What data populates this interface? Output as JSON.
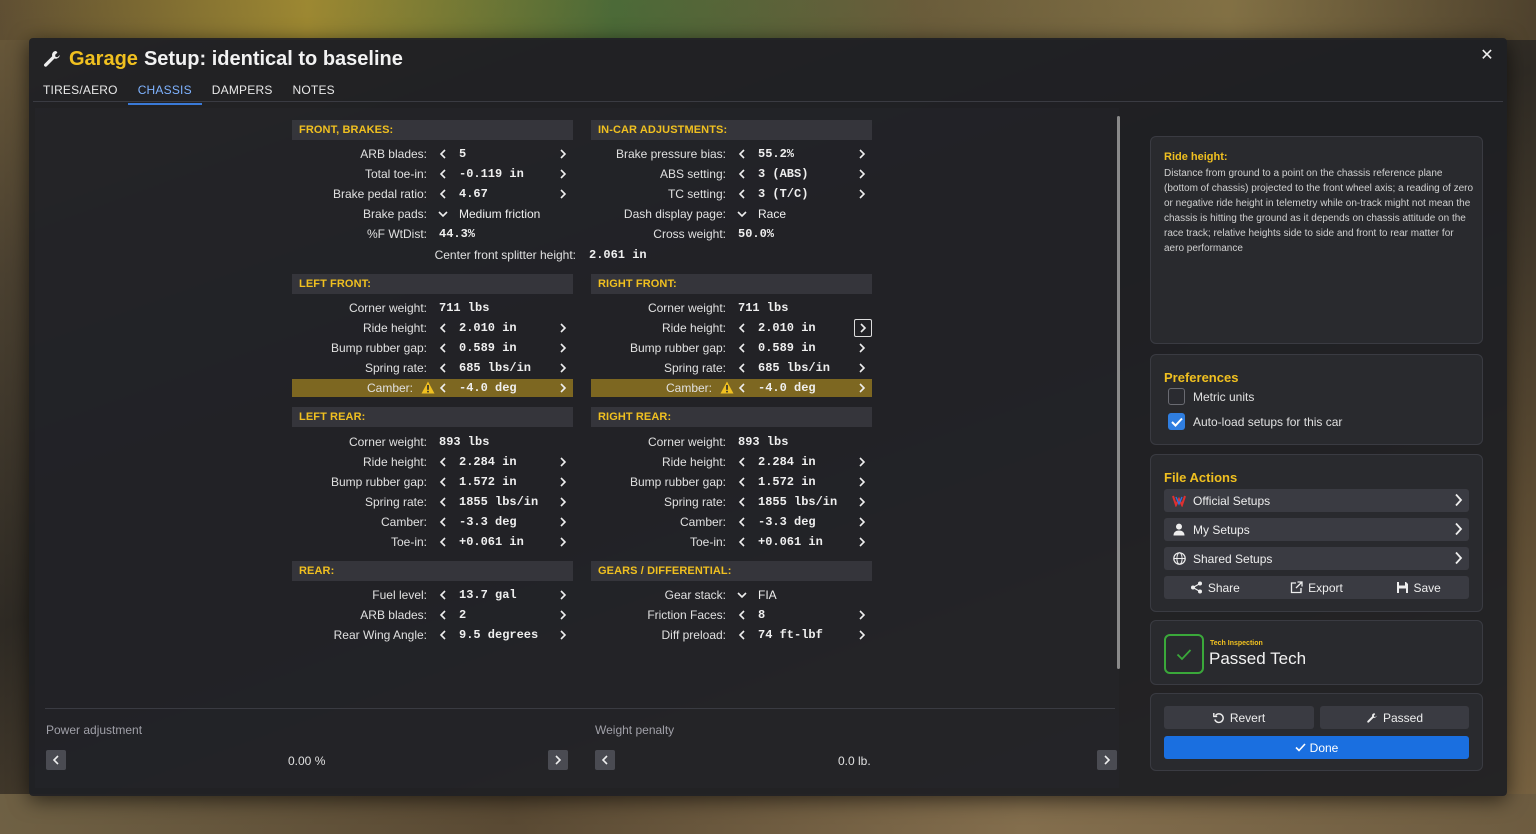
{
  "title": {
    "garage": "Garage",
    "main": "Setup: identical to baseline"
  },
  "tabs": [
    "TIRES/AERO",
    "CHASSIS",
    "DAMPERS",
    "NOTES"
  ],
  "sections": {
    "front_brakes": "FRONT, BRAKES:",
    "in_car": "IN-CAR ADJUSTMENTS:",
    "left_front": "LEFT FRONT:",
    "right_front": "RIGHT FRONT:",
    "left_rear": "LEFT REAR:",
    "right_rear": "RIGHT REAR:",
    "rear": "REAR:",
    "gears": "GEARS / DIFFERENTIAL:"
  },
  "front_brakes": [
    {
      "label": "ARB blades:",
      "value": "5"
    },
    {
      "label": "Total toe-in:",
      "value": "-0.119 in"
    },
    {
      "label": "Brake pedal ratio:",
      "value": "4.67"
    },
    {
      "label": "Brake pads:",
      "value": "Medium friction"
    },
    {
      "label": "%F WtDist:",
      "value": "44.3%"
    }
  ],
  "in_car": [
    {
      "label": "Brake pressure bias:",
      "value": "55.2%"
    },
    {
      "label": "ABS setting:",
      "value": "3 (ABS)"
    },
    {
      "label": "TC setting:",
      "value": "3 (T/C)"
    },
    {
      "label": "Dash display page:",
      "value": "Race"
    },
    {
      "label": "Cross weight:",
      "value": "50.0%"
    }
  ],
  "splitter": {
    "label": "Center front splitter height:",
    "value": "2.061 in"
  },
  "left_front": [
    {
      "label": "Corner weight:",
      "value": "711 lbs"
    },
    {
      "label": "Ride height:",
      "value": "2.010 in"
    },
    {
      "label": "Bump rubber gap:",
      "value": "0.589 in"
    },
    {
      "label": "Spring rate:",
      "value": "685 lbs/in"
    },
    {
      "label": "Camber:",
      "value": "-4.0 deg"
    }
  ],
  "right_front": [
    {
      "label": "Corner weight:",
      "value": "711 lbs"
    },
    {
      "label": "Ride height:",
      "value": "2.010 in"
    },
    {
      "label": "Bump rubber gap:",
      "value": "0.589 in"
    },
    {
      "label": "Spring rate:",
      "value": "685 lbs/in"
    },
    {
      "label": "Camber:",
      "value": "-4.0 deg"
    }
  ],
  "left_rear": [
    {
      "label": "Corner weight:",
      "value": "893 lbs"
    },
    {
      "label": "Ride height:",
      "value": "2.284 in"
    },
    {
      "label": "Bump rubber gap:",
      "value": "1.572 in"
    },
    {
      "label": "Spring rate:",
      "value": "1855 lbs/in"
    },
    {
      "label": "Camber:",
      "value": "-3.3 deg"
    },
    {
      "label": "Toe-in:",
      "value": "+0.061 in"
    }
  ],
  "right_rear": [
    {
      "label": "Corner weight:",
      "value": "893 lbs"
    },
    {
      "label": "Ride height:",
      "value": "2.284 in"
    },
    {
      "label": "Bump rubber gap:",
      "value": "1.572 in"
    },
    {
      "label": "Spring rate:",
      "value": "1855 lbs/in"
    },
    {
      "label": "Camber:",
      "value": "-3.3 deg"
    },
    {
      "label": "Toe-in:",
      "value": "+0.061 in"
    }
  ],
  "rear": [
    {
      "label": "Fuel level:",
      "value": "13.7 gal"
    },
    {
      "label": "ARB blades:",
      "value": "2"
    },
    {
      "label": "Rear Wing Angle:",
      "value": "9.5 degrees"
    }
  ],
  "gears": [
    {
      "label": "Gear stack:",
      "value": "FIA"
    },
    {
      "label": "Friction Faces:",
      "value": "8"
    },
    {
      "label": "Diff preload:",
      "value": "74 ft-lbf"
    }
  ],
  "bottom": {
    "power_label": "Power adjustment",
    "power_value": "0.00 %",
    "weight_label": "Weight penalty",
    "weight_value": "0.0 lb."
  },
  "help": {
    "title": "Ride height:",
    "text": "Distance from ground to a point on the chassis reference plane (bottom of chassis) projected to the front wheel axis; a reading of zero or negative ride height in telemetry while on-track might not mean the chassis is hitting the ground as it depends on chassis attitude on the race track; relative heights side to side and front to rear matter for aero performance"
  },
  "preferences": {
    "title": "Preferences",
    "metric": "Metric units",
    "metric_checked": false,
    "autoload": "Auto-load setups for this car",
    "autoload_checked": true
  },
  "file_actions": {
    "title": "File Actions",
    "official": "Official Setups",
    "my": "My Setups",
    "shared": "Shared Setups",
    "share": "Share",
    "export": "Export",
    "save": "Save"
  },
  "tech": {
    "small": "Tech Inspection",
    "big": "Passed Tech"
  },
  "actions": {
    "revert": "Revert",
    "passed": "Passed",
    "done": "Done"
  },
  "colors": {
    "accent": "#f0c020",
    "tab_active": "#7fb3ff",
    "done": "#1a6fe0",
    "pass": "#3aa83a",
    "highlight": "#c8a01e"
  }
}
